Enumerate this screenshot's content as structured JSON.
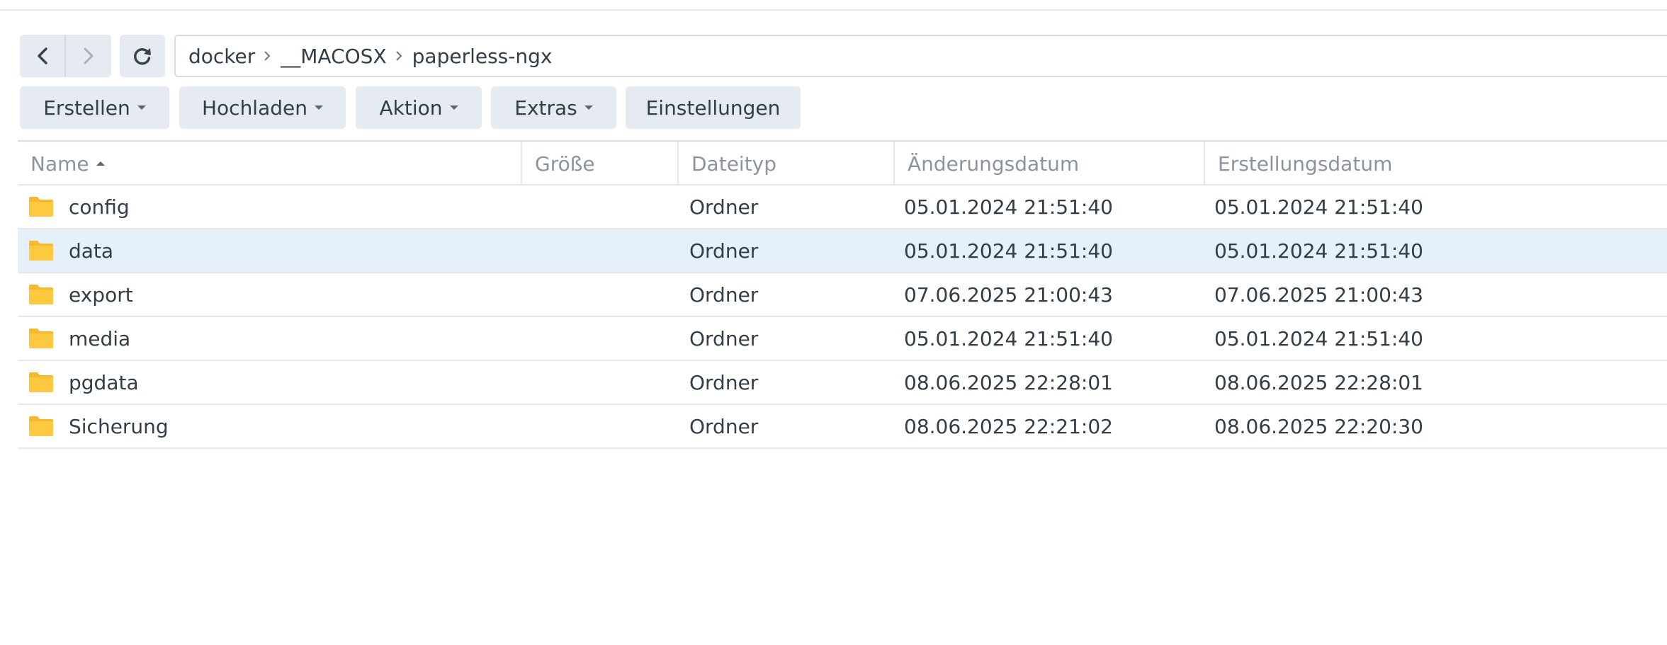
{
  "navigation": {
    "breadcrumb": [
      "docker",
      "__MACOSX",
      "paperless-ngx"
    ]
  },
  "toolbar": {
    "create_label": "Erstellen",
    "upload_label": "Hochladen",
    "action_label": "Aktion",
    "extras_label": "Extras",
    "settings_label": "Einstellungen"
  },
  "table": {
    "columns": {
      "name": "Name",
      "size": "Größe",
      "type": "Dateityp",
      "modified": "Änderungsdatum",
      "created": "Erstellungsdatum"
    },
    "rows": [
      {
        "name": "config",
        "size": "",
        "type": "Ordner",
        "modified": "05.01.2024 21:51:40",
        "created": "05.01.2024 21:51:40"
      },
      {
        "name": "data",
        "size": "",
        "type": "Ordner",
        "modified": "05.01.2024 21:51:40",
        "created": "05.01.2024 21:51:40"
      },
      {
        "name": "export",
        "size": "",
        "type": "Ordner",
        "modified": "07.06.2025 21:00:43",
        "created": "07.06.2025 21:00:43"
      },
      {
        "name": "media",
        "size": "",
        "type": "Ordner",
        "modified": "05.01.2024 21:51:40",
        "created": "05.01.2024 21:51:40"
      },
      {
        "name": "pgdata",
        "size": "",
        "type": "Ordner",
        "modified": "08.06.2025 22:28:01",
        "created": "08.06.2025 22:28:01"
      },
      {
        "name": "Sicherung",
        "size": "",
        "type": "Ordner",
        "modified": "08.06.2025 22:21:02",
        "created": "08.06.2025 22:20:30"
      }
    ],
    "selected_row": 1
  },
  "colors": {
    "folder": "#fcc93f",
    "folder_tab": "#f7b82c",
    "selected_row": "#e5f0fa",
    "button_bg": "#e6ebf2"
  },
  "icons": {
    "back": "chevron-left-icon",
    "forward": "chevron-right-icon",
    "refresh": "refresh-icon",
    "folder": "folder-icon"
  }
}
